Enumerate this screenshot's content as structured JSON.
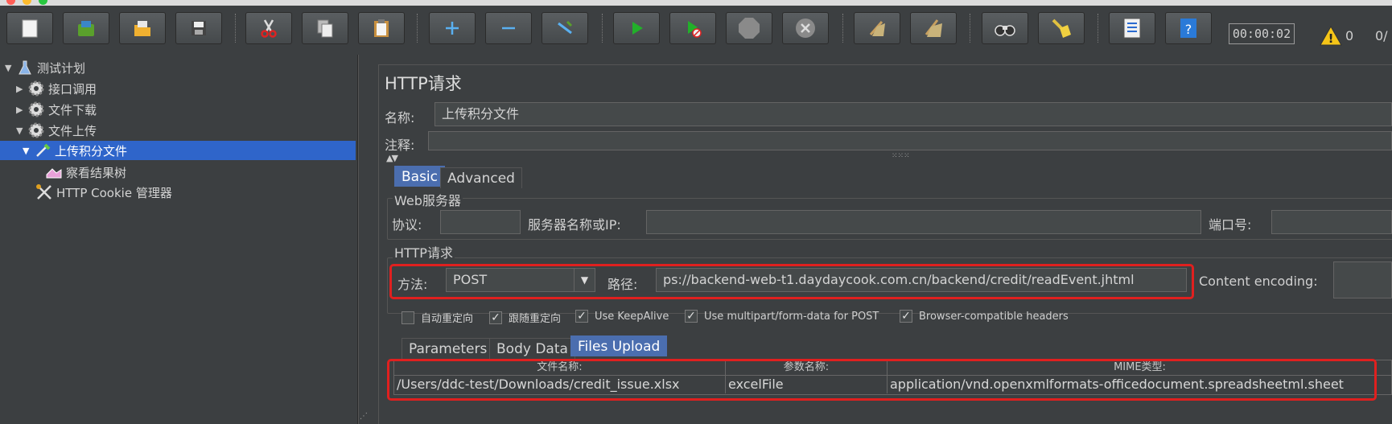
{
  "toolbar": {
    "timer": "00:00:02",
    "warning_count": "0",
    "thread_ratio": "0/",
    "icons": [
      "new-icon",
      "templates-icon",
      "open-icon",
      "save-icon",
      "cut-icon",
      "copy-icon",
      "paste-icon",
      "expand-icon",
      "collapse-icon",
      "toggle-icon",
      "start-icon",
      "start-no-pause-icon",
      "stop-icon",
      "shutdown-icon",
      "clear-icon",
      "clear-all-icon",
      "search-icon",
      "reset-search-icon",
      "function-helper-icon",
      "help-icon",
      "warning-icon"
    ]
  },
  "tree": {
    "items": [
      {
        "label": "测试计划"
      },
      {
        "label": "接口调用"
      },
      {
        "label": "文件下载"
      },
      {
        "label": "文件上传"
      },
      {
        "label": "上传积分文件"
      },
      {
        "label": "察看结果树"
      },
      {
        "label": "HTTP Cookie 管理器"
      }
    ]
  },
  "sampler": {
    "title": "HTTP请求",
    "name_label": "名称:",
    "name_value": "上传积分文件",
    "comment_label": "注释:",
    "tabs": [
      "Basic",
      "Advanced"
    ],
    "web_server": {
      "title": "Web服务器",
      "protocol_label": "协议:",
      "server_label": "服务器名称或IP:",
      "port_label": "端口号:"
    },
    "http_request": {
      "title": "HTTP请求",
      "method_label": "方法:",
      "method_value": "POST",
      "path_label": "路径:",
      "path_value": "ps://backend-web-t1.daydaycook.com.cn/backend/credit/readEvent.jhtml",
      "encoding_label": "Content encoding:"
    },
    "checkboxes": [
      {
        "label": "自动重定向",
        "checked": false
      },
      {
        "label": "跟随重定向",
        "checked": true
      },
      {
        "label": "Use KeepAlive",
        "checked": true
      },
      {
        "label": "Use multipart/form-data for POST",
        "checked": true
      },
      {
        "label": "Browser-compatible headers",
        "checked": true
      }
    ],
    "sub_tabs": [
      "Parameters",
      "Body Data",
      "Files Upload"
    ],
    "files_table": {
      "headers": [
        "文件名称:",
        "参数名称:",
        "MIME类型:"
      ],
      "rows": [
        [
          "/Users/ddc-test/Downloads/credit_issue.xlsx",
          "excelFile",
          "application/vnd.openxmlformats-officedocument.spreadsheetml.sheet"
        ]
      ]
    }
  },
  "colors": {
    "highlight": "#e0201f",
    "selection": "#2f65ca",
    "active_tab": "#4b6eaf"
  }
}
